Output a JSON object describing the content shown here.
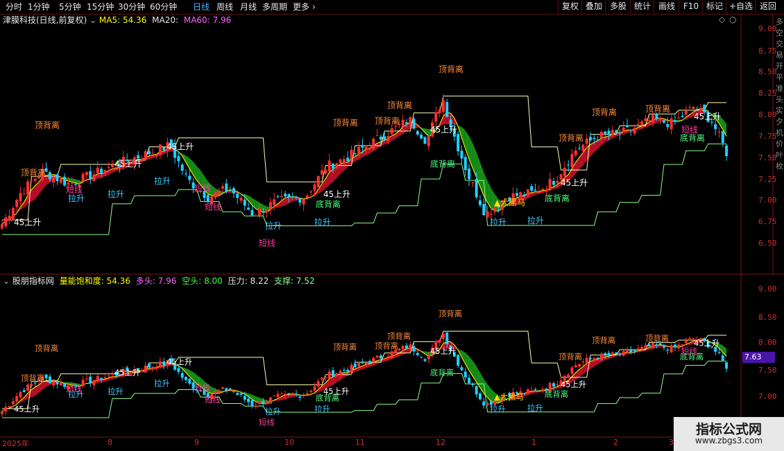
{
  "toolbar": {
    "periods": [
      "分时",
      "1分钟",
      "5分钟",
      "15分钟",
      "30分钟",
      "60分钟",
      "日线",
      "周线",
      "月线",
      "多周期",
      "更多"
    ],
    "active_period": "日线",
    "right_buttons": [
      "复权",
      "叠加",
      "多股",
      "统计",
      "画线",
      "F10",
      "标记",
      "+自选",
      "返回"
    ]
  },
  "main_panel": {
    "stock_name": "津膜科技(日线,前复权)",
    "ma5_label": "MA5:",
    "ma5_value": "54.36",
    "ma20_label": "MA20:",
    "ma60_label": "MA60:",
    "ma60_value": "7.96",
    "price_axis": [
      "9.00",
      "8.75",
      "8.50",
      "8.25",
      "8.00",
      "7.75",
      "7.50",
      "7.25",
      "7.00",
      "6.75",
      "6.50"
    ],
    "annotations": {
      "top_divergence": "顶背离",
      "bottom_divergence": "底背离",
      "rise_45": "45上升",
      "pull_up": "拉升",
      "short_line": "短线",
      "big_dark_horse": "大黑马"
    },
    "right_edge_chars": "多空交易开平准头实夕机价叶枚"
  },
  "indicator_panel": {
    "name": "股朋指标网",
    "energy_label": "量能饱和度:",
    "energy_value": "54.36",
    "long_label": "多头:",
    "long_value": "7.96",
    "short_label": "空头:",
    "short_value": "8.00",
    "pressure_label": "压力:",
    "pressure_value": "8.22",
    "support_label": "支撑:",
    "support_value": "7.52",
    "price_axis": [
      "9.00",
      "8.50",
      "8.00",
      "7.50",
      "7.00"
    ],
    "current_price": "7.63"
  },
  "time_axis": [
    "2025年",
    "8",
    "9",
    "10",
    "11",
    "12",
    "1",
    "2",
    "3"
  ],
  "watermark": {
    "title": "指标公式网",
    "url": "www.zbgs3.com"
  },
  "colors": {
    "bull": "#ff3030",
    "bear": "#20d0ff",
    "ma5": "#ffff00",
    "ma60": "#ff66ff",
    "ribbon_bull": "#c8102e",
    "ribbon_bear": "#1a9a1a",
    "support_line": "#8dff8d",
    "pressure_line": "#ffffb0",
    "axis_red": "#d03030"
  }
}
